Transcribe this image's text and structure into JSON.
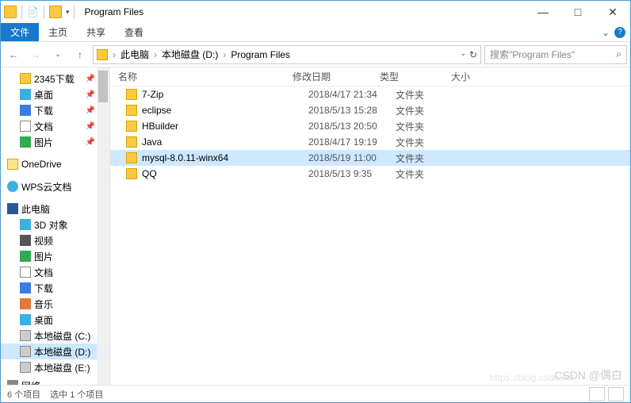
{
  "window": {
    "title": "Program Files",
    "min": "—",
    "max": "□",
    "close": "✕"
  },
  "ribbon": {
    "file": "文件",
    "home": "主页",
    "share": "共享",
    "view": "查看",
    "dropdown": "⌄",
    "help": "?"
  },
  "nav": {
    "back": "←",
    "fwd": "→",
    "hist": "⌄",
    "up": "↑",
    "crumb0": "此电脑",
    "crumb1": "本地磁盘 (D:)",
    "crumb2": "Program Files",
    "chev": "›",
    "refresh": "↻",
    "search_placeholder": "搜索\"Program Files\"",
    "mag": "🔍"
  },
  "columns": {
    "name": "名称",
    "date": "修改日期",
    "type": "类型",
    "size": "大小"
  },
  "rows": [
    {
      "name": "7-Zip",
      "date": "2018/4/17 21:34",
      "type": "文件夹",
      "sel": false
    },
    {
      "name": "eclipse",
      "date": "2018/5/13 15:28",
      "type": "文件夹",
      "sel": false
    },
    {
      "name": "HBuilder",
      "date": "2018/5/13 20:50",
      "type": "文件夹",
      "sel": false
    },
    {
      "name": "Java",
      "date": "2018/4/17 19:19",
      "type": "文件夹",
      "sel": false
    },
    {
      "name": "mysql-8.0.11-winx64",
      "date": "2018/5/19 11:00",
      "type": "文件夹",
      "sel": true
    },
    {
      "name": "QQ",
      "date": "2018/5/13 9:35",
      "type": "文件夹",
      "sel": false
    }
  ],
  "tree": [
    {
      "label": "2345下载",
      "icon": "folder",
      "lvl": 1,
      "pin": true
    },
    {
      "label": "桌面",
      "icon": "desk",
      "lvl": 1,
      "pin": true
    },
    {
      "label": "下载",
      "icon": "dl",
      "lvl": 1,
      "pin": true
    },
    {
      "label": "文档",
      "icon": "doc",
      "lvl": 1,
      "pin": true
    },
    {
      "label": "图片",
      "icon": "pic",
      "lvl": 1,
      "pin": true
    },
    {
      "spacer": true
    },
    {
      "label": "OneDrive",
      "icon": "onedrive",
      "lvl": 0
    },
    {
      "spacer": true
    },
    {
      "label": "WPS云文档",
      "icon": "cloud",
      "lvl": 0
    },
    {
      "spacer": true
    },
    {
      "label": "此电脑",
      "icon": "pc",
      "lvl": 0
    },
    {
      "label": "3D 对象",
      "icon": "cube",
      "lvl": 1
    },
    {
      "label": "视频",
      "icon": "vid",
      "lvl": 1
    },
    {
      "label": "图片",
      "icon": "pic",
      "lvl": 1
    },
    {
      "label": "文档",
      "icon": "doc",
      "lvl": 1
    },
    {
      "label": "下载",
      "icon": "dl",
      "lvl": 1
    },
    {
      "label": "音乐",
      "icon": "music",
      "lvl": 1
    },
    {
      "label": "桌面",
      "icon": "desk",
      "lvl": 1
    },
    {
      "label": "本地磁盘 (C:)",
      "icon": "drive",
      "lvl": 1
    },
    {
      "label": "本地磁盘 (D:)",
      "icon": "drive",
      "lvl": 1,
      "sel": true
    },
    {
      "label": "本地磁盘 (E:)",
      "icon": "drive",
      "lvl": 1
    },
    {
      "spacer": true,
      "small": true
    },
    {
      "label": "网络",
      "icon": "net",
      "lvl": 0
    }
  ],
  "status": {
    "count": "6 个项目",
    "sel": "选中 1 个项目"
  },
  "watermark": "CSDN @偶白",
  "watermark2": "https://blog.csdn.net"
}
